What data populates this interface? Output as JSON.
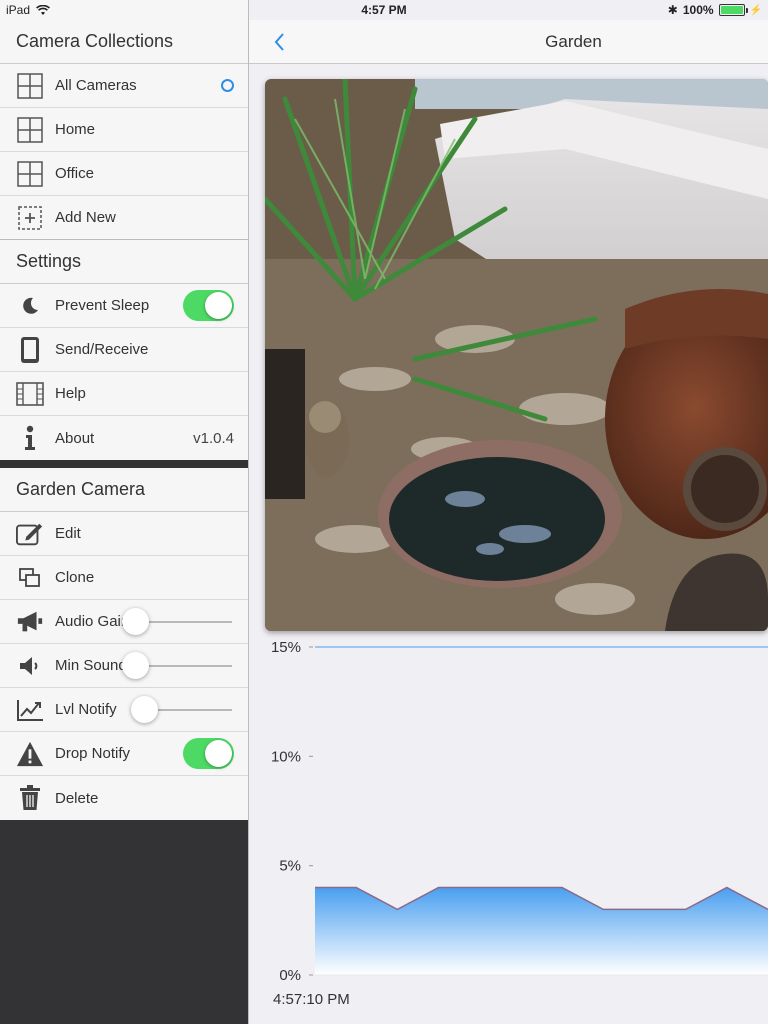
{
  "status_bar": {
    "device": "iPad",
    "time": "4:57 PM",
    "battery": "100%"
  },
  "sidebar": {
    "collections": {
      "header": "Camera Collections",
      "items": [
        {
          "label": "All Cameras",
          "icon": "grid-icon",
          "selected": true
        },
        {
          "label": "Home",
          "icon": "grid-icon"
        },
        {
          "label": "Office",
          "icon": "grid-icon"
        },
        {
          "label": "Add New",
          "icon": "add-box-icon"
        }
      ]
    },
    "settings": {
      "header": "Settings",
      "prevent_sleep": {
        "label": "Prevent Sleep",
        "on": true
      },
      "send_receive": {
        "label": "Send/Receive"
      },
      "help": {
        "label": "Help"
      },
      "about": {
        "label": "About",
        "version": "v1.0.4"
      }
    },
    "camera": {
      "header": "Garden Camera",
      "edit": "Edit",
      "clone": "Clone",
      "audio_gain": {
        "label": "Audio Gain",
        "value": 0.0
      },
      "min_sound": {
        "label": "Min Sound",
        "value": 0.0
      },
      "lvl_notify": {
        "label": "Lvl Notify",
        "value": 0.1
      },
      "drop_notify": {
        "label": "Drop Notify",
        "on": true
      },
      "delete": "Delete"
    }
  },
  "navbar": {
    "title": "Garden"
  },
  "colors": {
    "accent": "#2e8ee6",
    "toggle_on": "#4cd964",
    "sidebar_dark": "#333335"
  },
  "chart_data": {
    "type": "area",
    "y_ticks": [
      "0%",
      "5%",
      "10%",
      "15%"
    ],
    "ylim": [
      0,
      15
    ],
    "x_label": "4:57:10 PM",
    "threshold": 15,
    "values": [
      4,
      4,
      3,
      4,
      4,
      4,
      4,
      3,
      3,
      3,
      4,
      3
    ]
  }
}
